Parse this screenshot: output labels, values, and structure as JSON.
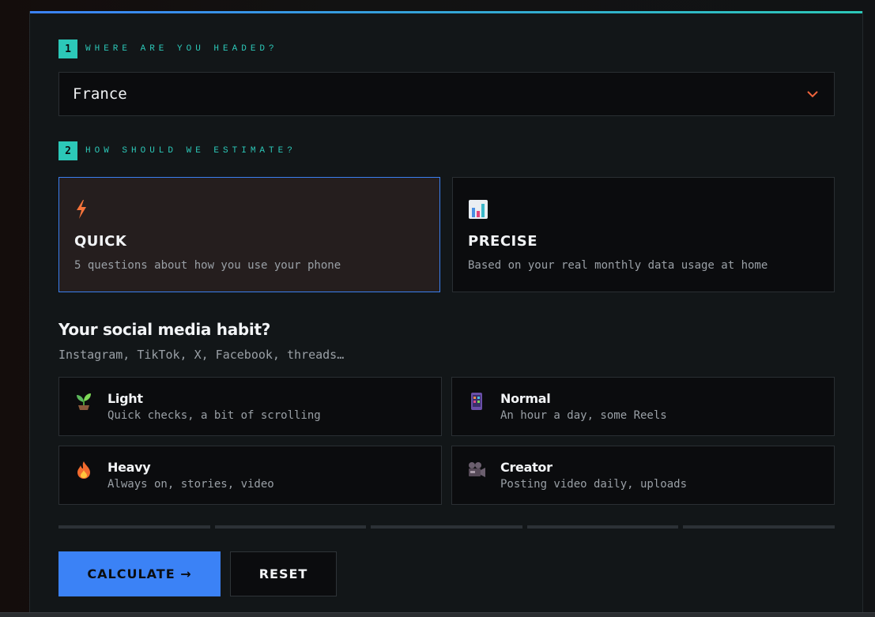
{
  "step1": {
    "number": "1",
    "label": "WHERE ARE YOU HEADED?"
  },
  "destination": {
    "value": "France"
  },
  "step2": {
    "number": "2",
    "label": "HOW SHOULD WE ESTIMATE?"
  },
  "modes": [
    {
      "title": "QUICK",
      "description": "5 questions about how you use your phone",
      "icon": "lightning-icon",
      "selected": true
    },
    {
      "title": "PRECISE",
      "description": "Based on your real monthly data usage at home",
      "icon": "bar-chart-icon",
      "selected": false
    }
  ],
  "question": {
    "title": "Your social media habit?",
    "subtitle": "Instagram, TikTok, X, Facebook, threads…",
    "options": [
      {
        "title": "Light",
        "description": "Quick checks, a bit of scrolling",
        "icon": "seedling-icon"
      },
      {
        "title": "Normal",
        "description": "An hour a day, some Reels",
        "icon": "phone-icon"
      },
      {
        "title": "Heavy",
        "description": "Always on, stories, video",
        "icon": "fire-icon"
      },
      {
        "title": "Creator",
        "description": "Posting video daily, uploads",
        "icon": "video-camera-icon"
      }
    ]
  },
  "progress": {
    "current_question": 0,
    "total_questions": 5
  },
  "actions": {
    "calculate_label": "CALCULATE →",
    "reset_label": "RESET"
  },
  "colors": {
    "accent_teal": "#2cc8b8",
    "accent_blue": "#3b82f6",
    "chevron": "#f0643c"
  }
}
